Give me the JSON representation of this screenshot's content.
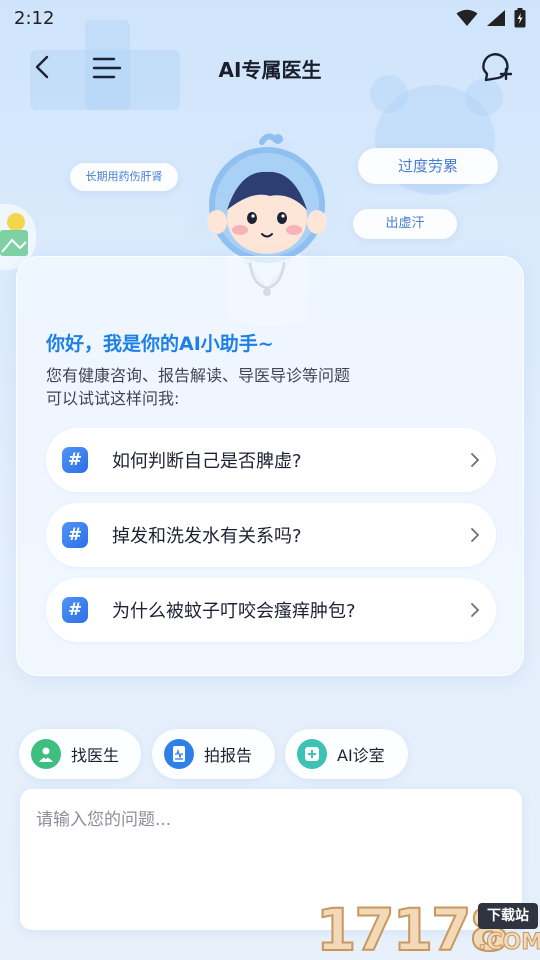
{
  "status_bar": {
    "time": "2:12"
  },
  "nav": {
    "title": "AI专属医生"
  },
  "bubbles": {
    "tag_1": "长期用药伤肝肾",
    "tag_2": "过度劳累",
    "tag_3": "出虚汗"
  },
  "assistant": {
    "greeting": "你好，我是你的AI小助手~",
    "intro_line_1": "您有健康咨询、报告解读、导医导诊等问题",
    "intro_line_2": "可以试试这样问我:"
  },
  "questions": [
    {
      "hash": "#",
      "text": "如何判断自己是否脾虚?"
    },
    {
      "hash": "#",
      "text": "掉发和洗发水有关系吗?"
    },
    {
      "hash": "#",
      "text": "为什么被蚊子叮咬会瘙痒肿包?"
    }
  ],
  "tools": [
    {
      "label": "找医生",
      "icon": "doctor-icon",
      "color": "#3fbf7f"
    },
    {
      "label": "拍报告",
      "icon": "report-icon",
      "color": "#2f7fe8"
    },
    {
      "label": "AI诊室",
      "icon": "clinic-icon",
      "color": "#3cc3b3"
    }
  ],
  "input": {
    "placeholder": "请输入您的问题...",
    "value": ""
  },
  "watermark": {
    "digits": "17178",
    "tag": "下载站",
    "suffix": ".COM"
  },
  "colors": {
    "accent": "#1d7fe8",
    "background": "#dcebfc"
  }
}
